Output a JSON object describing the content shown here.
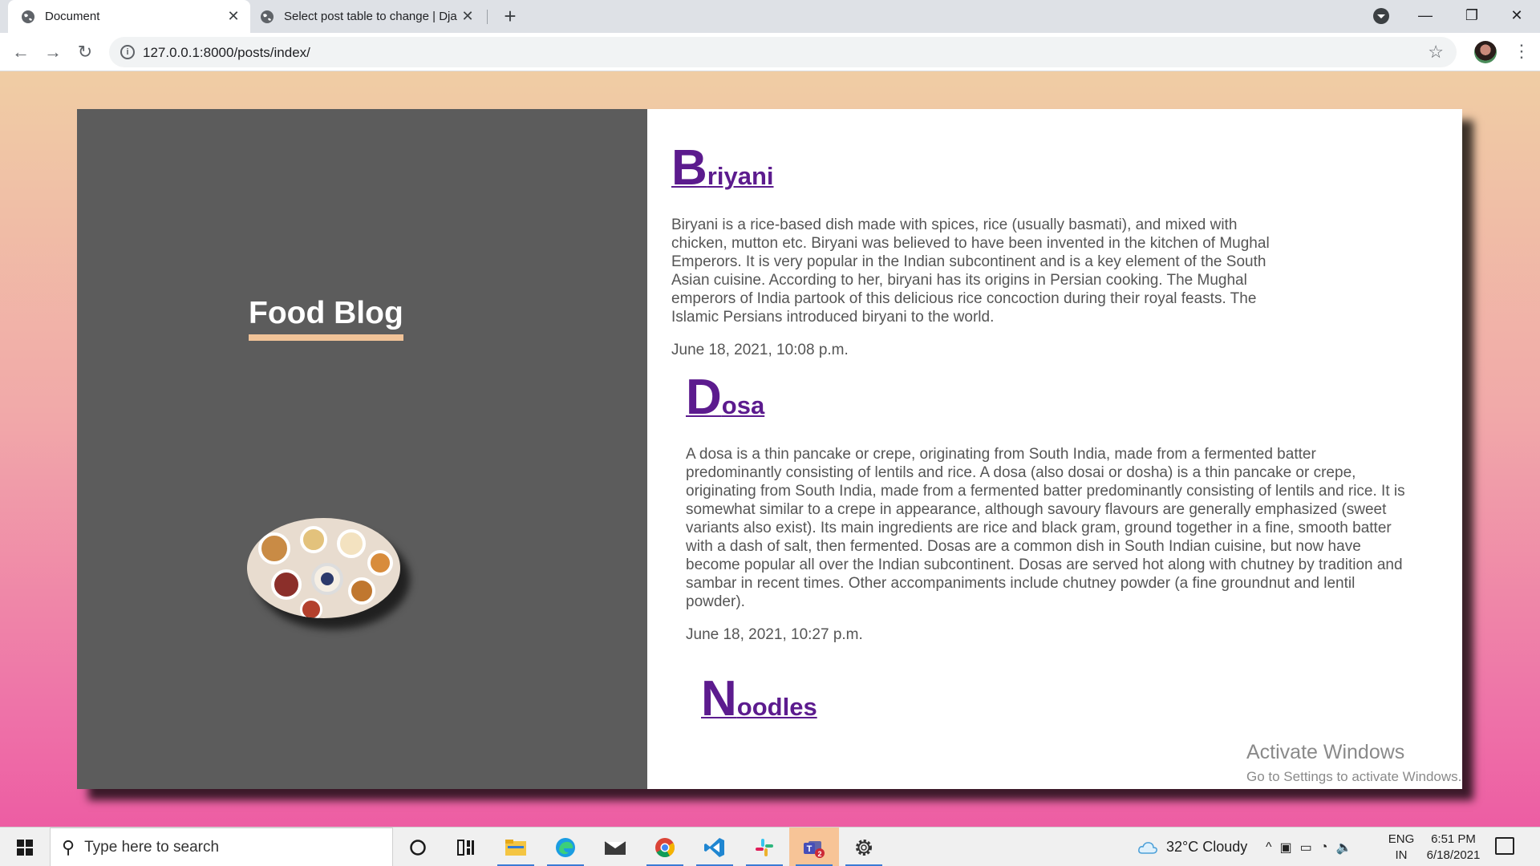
{
  "browser": {
    "tabs": [
      {
        "title": "Document",
        "active": true
      },
      {
        "title": "Select post table to change | Djan",
        "active": false
      }
    ],
    "url": "127.0.0.1:8000/posts/index/"
  },
  "page": {
    "blog_title": "Food Blog",
    "posts": [
      {
        "title_first": "B",
        "title_rest": "riyani",
        "body": "Biryani is a rice-based dish made with spices, rice (usually basmati), and mixed with chicken, mutton etc. Biryani was believed to have been invented in the kitchen of Mughal Emperors. It is very popular in the Indian subcontinent and is a key element of the South Asian cuisine. According to her, biryani has its origins in Persian cooking. The Mughal emperors of India partook of this delicious rice concoction during their royal feasts. The Islamic Persians introduced biryani to the world.",
        "date": "June 18, 2021, 10:08 p.m."
      },
      {
        "title_first": "D",
        "title_rest": "osa",
        "body": "A dosa is a thin pancake or crepe, originating from South India, made from a fermented batter predominantly consisting of lentils and rice. A dosa (also dosai or dosha) is a thin pancake or crepe, originating from South India, made from a fermented batter predominantly consisting of lentils and rice. It is somewhat similar to a crepe in appearance, although savoury flavours are generally emphasized (sweet variants also exist). Its main ingredients are rice and black gram, ground together in a fine, smooth batter with a dash of salt, then fermented. Dosas are a common dish in South Indian cuisine, but now have become popular all over the Indian subcontinent. Dosas are served hot along with chutney by tradition and sambar in recent times. Other accompaniments include chutney powder (a fine groundnut and lentil powder).",
        "date": "June 18, 2021, 10:27 p.m."
      },
      {
        "title_first": "N",
        "title_rest": "oodles"
      }
    ],
    "watermark": {
      "line1": "Activate Windows",
      "line2": "Go to Settings to activate Windows."
    }
  },
  "taskbar": {
    "search_placeholder": "Type here to search",
    "weather": "32°C  Cloudy",
    "lang_line1": "ENG",
    "lang_line2": "IN",
    "time": "6:51 PM",
    "date": "6/18/2021",
    "teams_badge": "2"
  },
  "colors": {
    "title_link": "#5c1b8e",
    "left_panel": "#5c5c5c",
    "title_underline": "#f1c398",
    "background_top": "#f0cda4",
    "background_bottom": "#ed5da3"
  }
}
